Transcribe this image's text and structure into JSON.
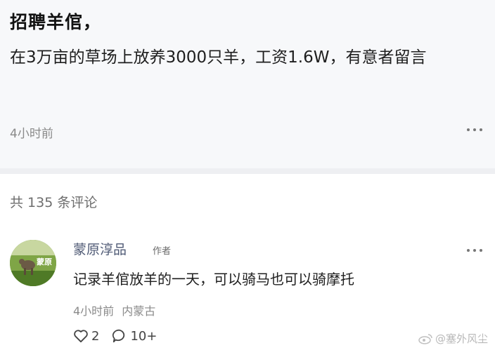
{
  "post": {
    "title": "招聘羊倌，",
    "body": "在3万亩的草场上放养3000只羊，工资1.6W，有意者留言",
    "time": "4小时前"
  },
  "comments_section": {
    "count_label": "共 135 条评论"
  },
  "comment": {
    "author": "蒙原淳品",
    "author_tag": "作者",
    "avatar_text": "蒙原",
    "text": "记录羊倌放羊的一天，可以骑马也可以骑摩托",
    "time": "4小时前",
    "location": "内蒙古",
    "likes": "2",
    "replies": "10+"
  },
  "watermark": "@塞外风尘",
  "icons": {
    "more": "more-dots-icon",
    "like": "heart-icon",
    "reply": "chat-bubble-icon",
    "watermark": "weibo-icon"
  }
}
